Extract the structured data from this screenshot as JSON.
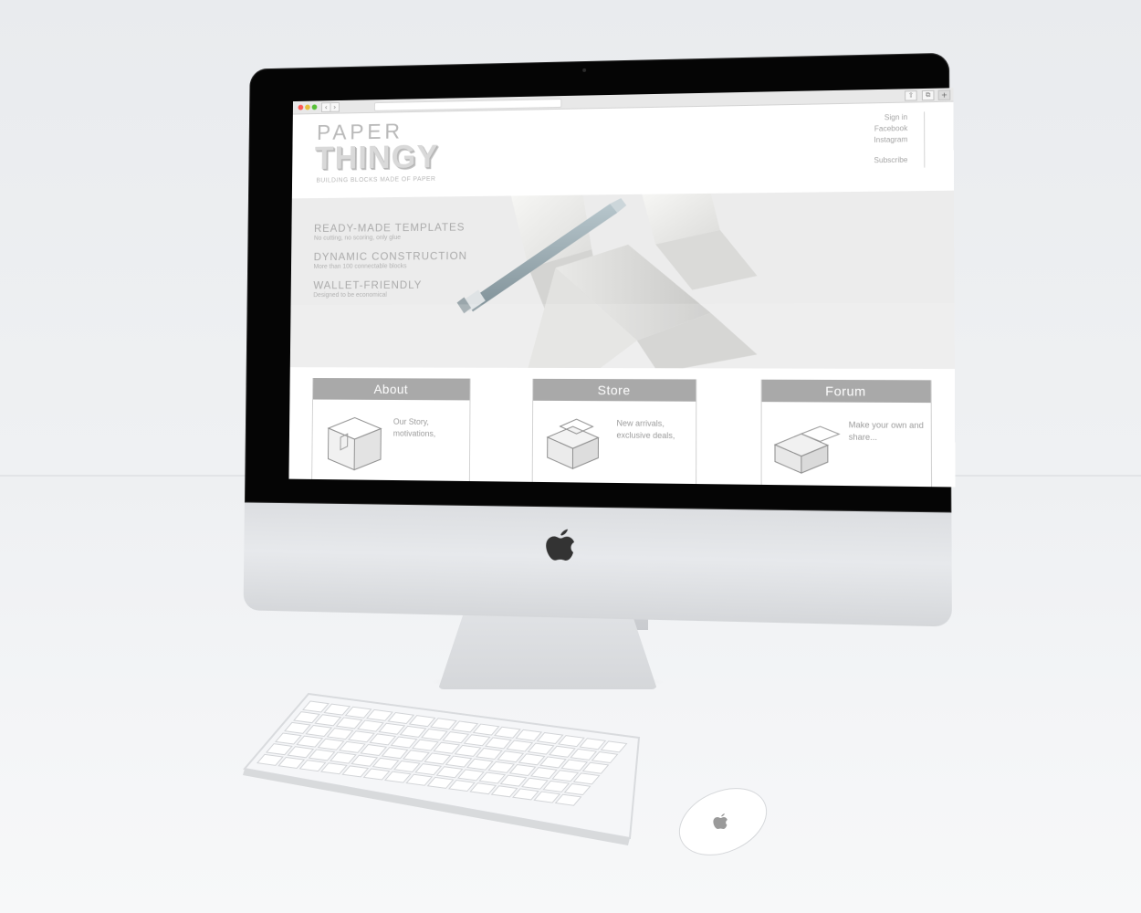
{
  "browser": {
    "back_glyph": "‹",
    "forward_glyph": "›",
    "share_glyph": "⇪",
    "tabs_glyph": "⧉",
    "new_tab_glyph": "+"
  },
  "site": {
    "logo_top": "PAPER",
    "logo_main": "THINGY",
    "tagline": "BUILDING BLOCKS MADE OF PAPER",
    "links": [
      "Sign in",
      "Facebook",
      "Instagram"
    ],
    "subscribe": "Subscribe"
  },
  "hero": {
    "features": [
      {
        "title": "READY-MADE TEMPLATES",
        "subtitle": "No cutting, no scoring, only glue"
      },
      {
        "title": "DYNAMIC CONSTRUCTION",
        "subtitle": "More than 100 connectable blocks"
      },
      {
        "title": "WALLET-FRIENDLY",
        "subtitle": "Designed to be economical"
      }
    ]
  },
  "cards": [
    {
      "heading": "About",
      "text": "Our Story, motivations,"
    },
    {
      "heading": "Store",
      "text": "New arrivals, exclusive deals,"
    },
    {
      "heading": "Forum",
      "text": "Make your own and share..."
    }
  ],
  "colors": {
    "card_header": "#a9a9a9",
    "browser_red": "#fc5b57",
    "browser_yellow": "#e5bf3c",
    "browser_green": "#57c038",
    "bezel": "#050505"
  },
  "icons": {
    "device_logo": "apple-logo-icon",
    "pen": "pen-icon",
    "paper_blocks": "paper-block-icon"
  }
}
